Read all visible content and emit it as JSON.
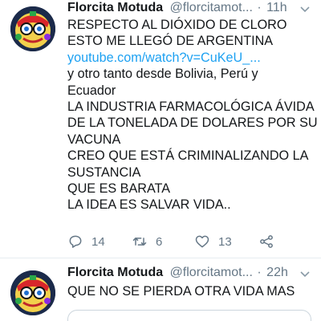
{
  "tweets": [
    {
      "author_name": "Florcita Motuda",
      "handle": "@florcitamot...",
      "separator": "·",
      "time": "11h",
      "lines": [
        "RESPECTO AL DIÓXIDO DE CLORO",
        "ESTO ME LLEGÓ DE ARGENTINA",
        "youtube.com/watch?v=CuKeU_...",
        "y otro tanto desde Bolivia, Perú y",
        "Ecuador",
        "LA INDUSTRIA FARMACOLÓGICA ÁVIDA",
        "DE LA TONELADA DE DOLARES POR SU",
        "VACUNA",
        "CREO QUE ESTÁ CRIMINALIZANDO LA",
        "SUSTANCIA",
        "QUE ES BARATA",
        "LA IDEA ES SALVAR VIDA.."
      ],
      "replies": "14",
      "retweets": "6",
      "likes": "13"
    },
    {
      "author_name": "Florcita Motuda",
      "handle": "@florcitamot...",
      "separator": "·",
      "time": "22h",
      "lines": [
        "QUE NO SE PIERDA OTRA VIDA MAS"
      ]
    }
  ],
  "colors": {
    "link": "#1da1f2",
    "secondary_text": "#657786",
    "primary_text": "#14171a",
    "divider": "#e6ecf0"
  },
  "icons": {
    "reply": "reply-icon",
    "retweet": "retweet-icon",
    "like": "heart-icon",
    "share": "share-icon",
    "menu": "chevron-down-icon"
  }
}
